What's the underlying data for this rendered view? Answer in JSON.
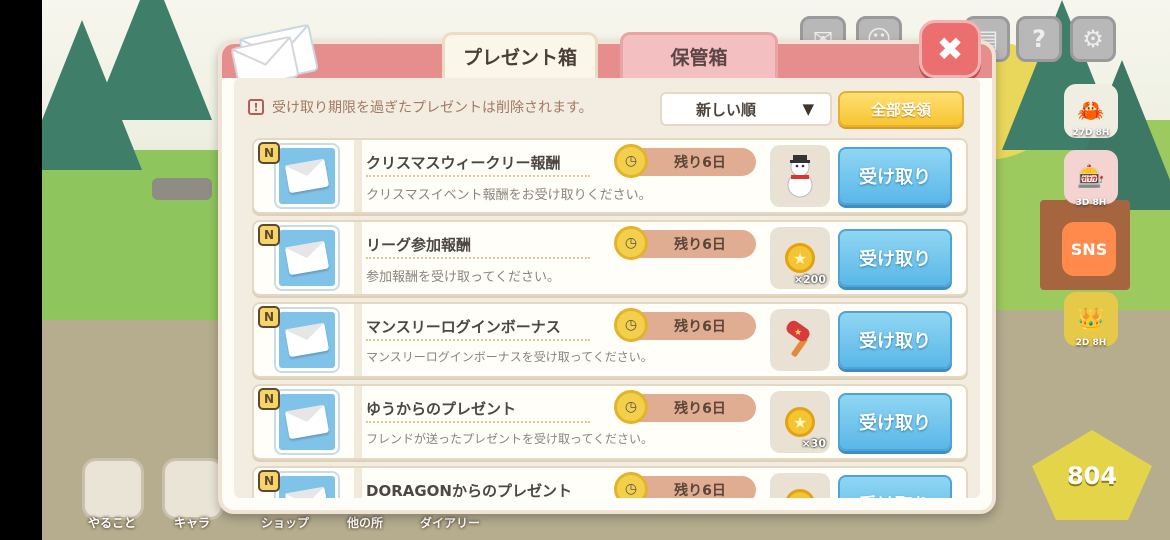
{
  "tabs": [
    {
      "label": "プレゼント箱",
      "active": true
    },
    {
      "label": "保管箱",
      "active": false
    }
  ],
  "notice": {
    "text": "受け取り期限を過ぎたプレゼントは削除されます。",
    "icon": "exclamation-icon"
  },
  "sort": {
    "selected": "新しい順"
  },
  "claim_all_label": "全部受領",
  "receive_label": "受け取り",
  "rows": [
    {
      "title": "クリスマスウィークリー報酬",
      "description": "クリスマスイベント報酬をお受け取りください。",
      "remaining": "残り6日",
      "reward_icon": "snowman-icon",
      "reward_qty": ""
    },
    {
      "title": "リーグ参加報酬",
      "description": "参加報酬を受け取ってください。",
      "remaining": "残り6日",
      "reward_icon": "coin-icon",
      "reward_qty": "×200"
    },
    {
      "title": "マンスリーログインボーナス",
      "description": "マンスリーログインボーナスを受け取ってください。",
      "remaining": "残り6日",
      "reward_icon": "hammer-icon",
      "reward_qty": ""
    },
    {
      "title": "ゆうからのプレゼント",
      "description": "フレンドが送ったプレゼントを受け取ってください。",
      "remaining": "残り6日",
      "reward_icon": "coin-icon",
      "reward_qty": "×30"
    },
    {
      "title": "DORAGONからのプレゼント",
      "description": "",
      "remaining": "残り6日",
      "reward_icon": "coin-icon",
      "reward_qty": ""
    }
  ],
  "new_badge": "N",
  "background": {
    "side_labels": [
      "27D 8H",
      "3D 8H",
      "2D 8H"
    ],
    "sns_label": "SNS",
    "gem_count": "804",
    "bottom_nav": [
      "やること",
      "キャラ",
      "ショップ",
      "他の所",
      "ダイアリー"
    ]
  },
  "colors": {
    "header": "#e68d8d",
    "receive_button": "#5ab7e8",
    "claim_all": "#f7c431",
    "close": "#ec6f6f"
  }
}
